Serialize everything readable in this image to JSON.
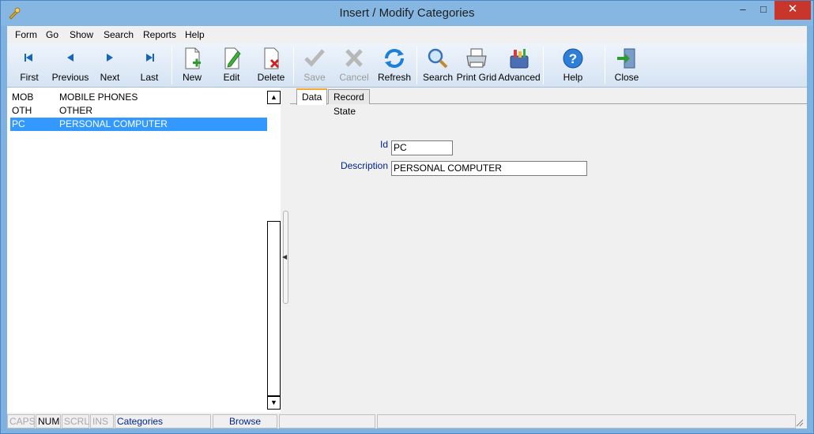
{
  "window": {
    "title": "Insert / Modify Categories",
    "minimize": "–",
    "maximize": "□",
    "close": "✕"
  },
  "menu": [
    "Form",
    "Go",
    "Show",
    "Search",
    "Reports",
    "Help"
  ],
  "toolbar": {
    "first": "First",
    "previous": "Previous",
    "next": "Next",
    "last": "Last",
    "new": "New",
    "edit": "Edit",
    "delete": "Delete",
    "save": "Save",
    "cancel": "Cancel",
    "refresh": "Refresh",
    "search": "Search",
    "print_grid": "Print Grid",
    "advanced": "Advanced",
    "help": "Help",
    "close": "Close"
  },
  "list": {
    "rows": [
      {
        "code": "MOB",
        "desc": "MOBILE PHONES",
        "selected": false
      },
      {
        "code": "OTH",
        "desc": "OTHER",
        "selected": false
      },
      {
        "code": "PC",
        "desc": "PERSONAL COMPUTER",
        "selected": true
      }
    ]
  },
  "tabs": [
    "Data",
    "Record State"
  ],
  "form": {
    "id_label": "Id",
    "id_value": "PC",
    "desc_label": "Description",
    "desc_value": "PERSONAL COMPUTER"
  },
  "status": {
    "caps": "CAPS",
    "num": "NUM",
    "scrl": "SCRL",
    "ins": "INS",
    "entity": "Categories",
    "mode": "Browse"
  },
  "colors": {
    "selection": "#3399ff",
    "label_blue": "#00238f",
    "close_red": "#c7352b"
  }
}
